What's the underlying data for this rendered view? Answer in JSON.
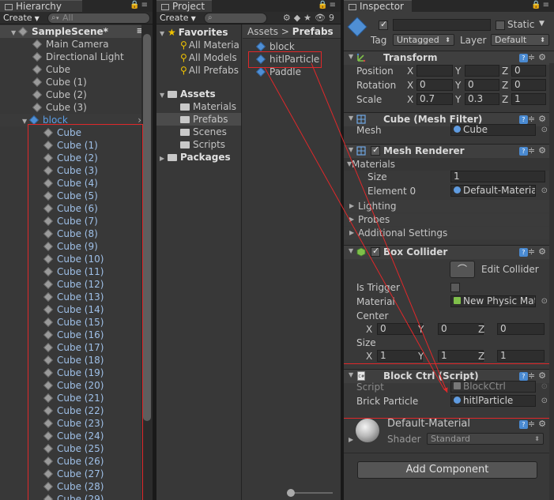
{
  "hierarchy": {
    "tab_title": "Hierarchy",
    "create_label": "Create",
    "search_placeholder": "All",
    "scene": "SampleScene*",
    "roots": [
      "Main Camera",
      "Directional Light",
      "Cube",
      "Cube (1)",
      "Cube (2)",
      "Cube (3)"
    ],
    "parent": "block",
    "children": [
      "Cube",
      "Cube (1)",
      "Cube (2)",
      "Cube (3)",
      "Cube (4)",
      "Cube (5)",
      "Cube (6)",
      "Cube (7)",
      "Cube (8)",
      "Cube (9)",
      "Cube (10)",
      "Cube (11)",
      "Cube (12)",
      "Cube (13)",
      "Cube (14)",
      "Cube (15)",
      "Cube (16)",
      "Cube (17)",
      "Cube (18)",
      "Cube (19)",
      "Cube (20)",
      "Cube (21)",
      "Cube (22)",
      "Cube (23)",
      "Cube (24)",
      "Cube (25)",
      "Cube (26)",
      "Cube (27)",
      "Cube (28)",
      "Cube (29)"
    ]
  },
  "project": {
    "tab_title": "Project",
    "create_label": "Create",
    "eye_count": "9",
    "favorites_label": "Favorites",
    "favorites": [
      "All Materia",
      "All Models",
      "All Prefabs"
    ],
    "assets_label": "Assets",
    "asset_folders": [
      "Materials",
      "Prefabs",
      "Scenes",
      "Scripts"
    ],
    "packages_label": "Packages",
    "breadcrumb_root": "Assets",
    "breadcrumb_sep": ">",
    "breadcrumb_current": "Prefabs",
    "prefabs": [
      "block",
      "hitlParticle",
      "Paddle"
    ]
  },
  "inspector": {
    "tab_title": "Inspector",
    "object_name": "",
    "static_label": "Static",
    "tag_label": "Tag",
    "tag_value": "Untagged",
    "layer_label": "Layer",
    "layer_value": "Default",
    "transform": {
      "title": "Transform",
      "position_label": "Position",
      "rotation_label": "Rotation",
      "scale_label": "Scale",
      "x": "X",
      "y": "Y",
      "z": "Z",
      "position": [
        "",
        "",
        "0"
      ],
      "rotation": [
        "0",
        "0",
        "0"
      ],
      "scale": [
        "0.7",
        "0.3",
        "1"
      ]
    },
    "mesh_filter": {
      "title": "Cube (Mesh Filter)",
      "mesh_label": "Mesh",
      "mesh_value": "Cube"
    },
    "mesh_renderer": {
      "title": "Mesh Renderer",
      "materials_label": "Materials",
      "size_label": "Size",
      "size_value": "1",
      "element_label": "Element 0",
      "element_value": "Default-Materia",
      "lighting_label": "Lighting",
      "probes_label": "Probes",
      "additional_label": "Additional Settings"
    },
    "box_collider": {
      "title": "Box Collider",
      "edit_label": "Edit Collider",
      "trigger_label": "Is Trigger",
      "material_label": "Material",
      "material_value": "New Physic Mat",
      "center_label": "Center",
      "center": [
        "0",
        "0",
        "0"
      ],
      "size_label": "Size",
      "size": [
        "1",
        "1",
        "1"
      ]
    },
    "block_ctrl": {
      "title": "Block Ctrl (Script)",
      "script_label": "Script",
      "script_value": "BlockCtrl",
      "brick_label": "Brick Particle",
      "brick_value": "hitlParticle"
    },
    "material": {
      "name": "Default-Material",
      "shader_label": "Shader",
      "shader_value": "Standard"
    },
    "add_component": "Add Component"
  },
  "colors": {
    "annotation": "#e0282a",
    "selection_blue": "#5d9ee5",
    "cube_blue": "#4f8fd4"
  }
}
